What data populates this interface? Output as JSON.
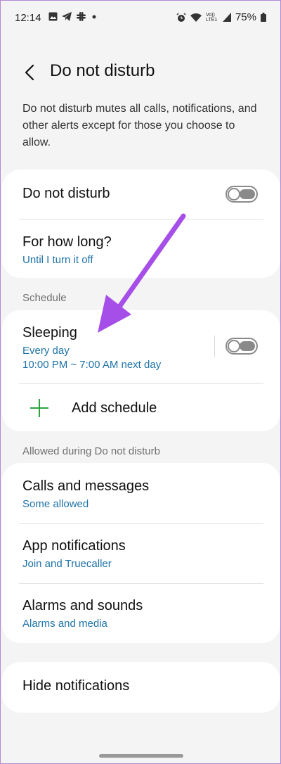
{
  "status_bar": {
    "time": "12:14",
    "icons_left": [
      "gallery-icon",
      "telegram-icon",
      "slack-icon",
      "dot-icon"
    ],
    "icons_right": [
      "alarm-icon",
      "wifi-icon",
      "volte-icon",
      "signal-icon"
    ],
    "volte_label": "Vo)) LTE1",
    "battery": "75%"
  },
  "header": {
    "title": "Do not disturb"
  },
  "description": "Do not disturb mutes all calls, notifications, and other alerts except for those you choose to allow.",
  "main_card": {
    "dnd_label": "Do not disturb",
    "dnd_on": false,
    "duration_label": "For how long?",
    "duration_value": "Until I turn it off"
  },
  "schedule": {
    "section_label": "Schedule",
    "items": [
      {
        "title": "Sleeping",
        "days": "Every day",
        "time": "10:00 PM ~ 7:00 AM next day",
        "enabled": false
      }
    ],
    "add_label": "Add schedule"
  },
  "allowed": {
    "section_label": "Allowed during Do not disturb",
    "items": [
      {
        "title": "Calls and messages",
        "sub": "Some allowed"
      },
      {
        "title": "App notifications",
        "sub": "Join and Truecaller"
      },
      {
        "title": "Alarms and sounds",
        "sub": "Alarms and media"
      }
    ]
  },
  "hide_notifications": {
    "label": "Hide notifications"
  },
  "colors": {
    "accent": "#1e73a8",
    "annotation_arrow": "#a64ee8",
    "plus": "#2aa63d"
  }
}
